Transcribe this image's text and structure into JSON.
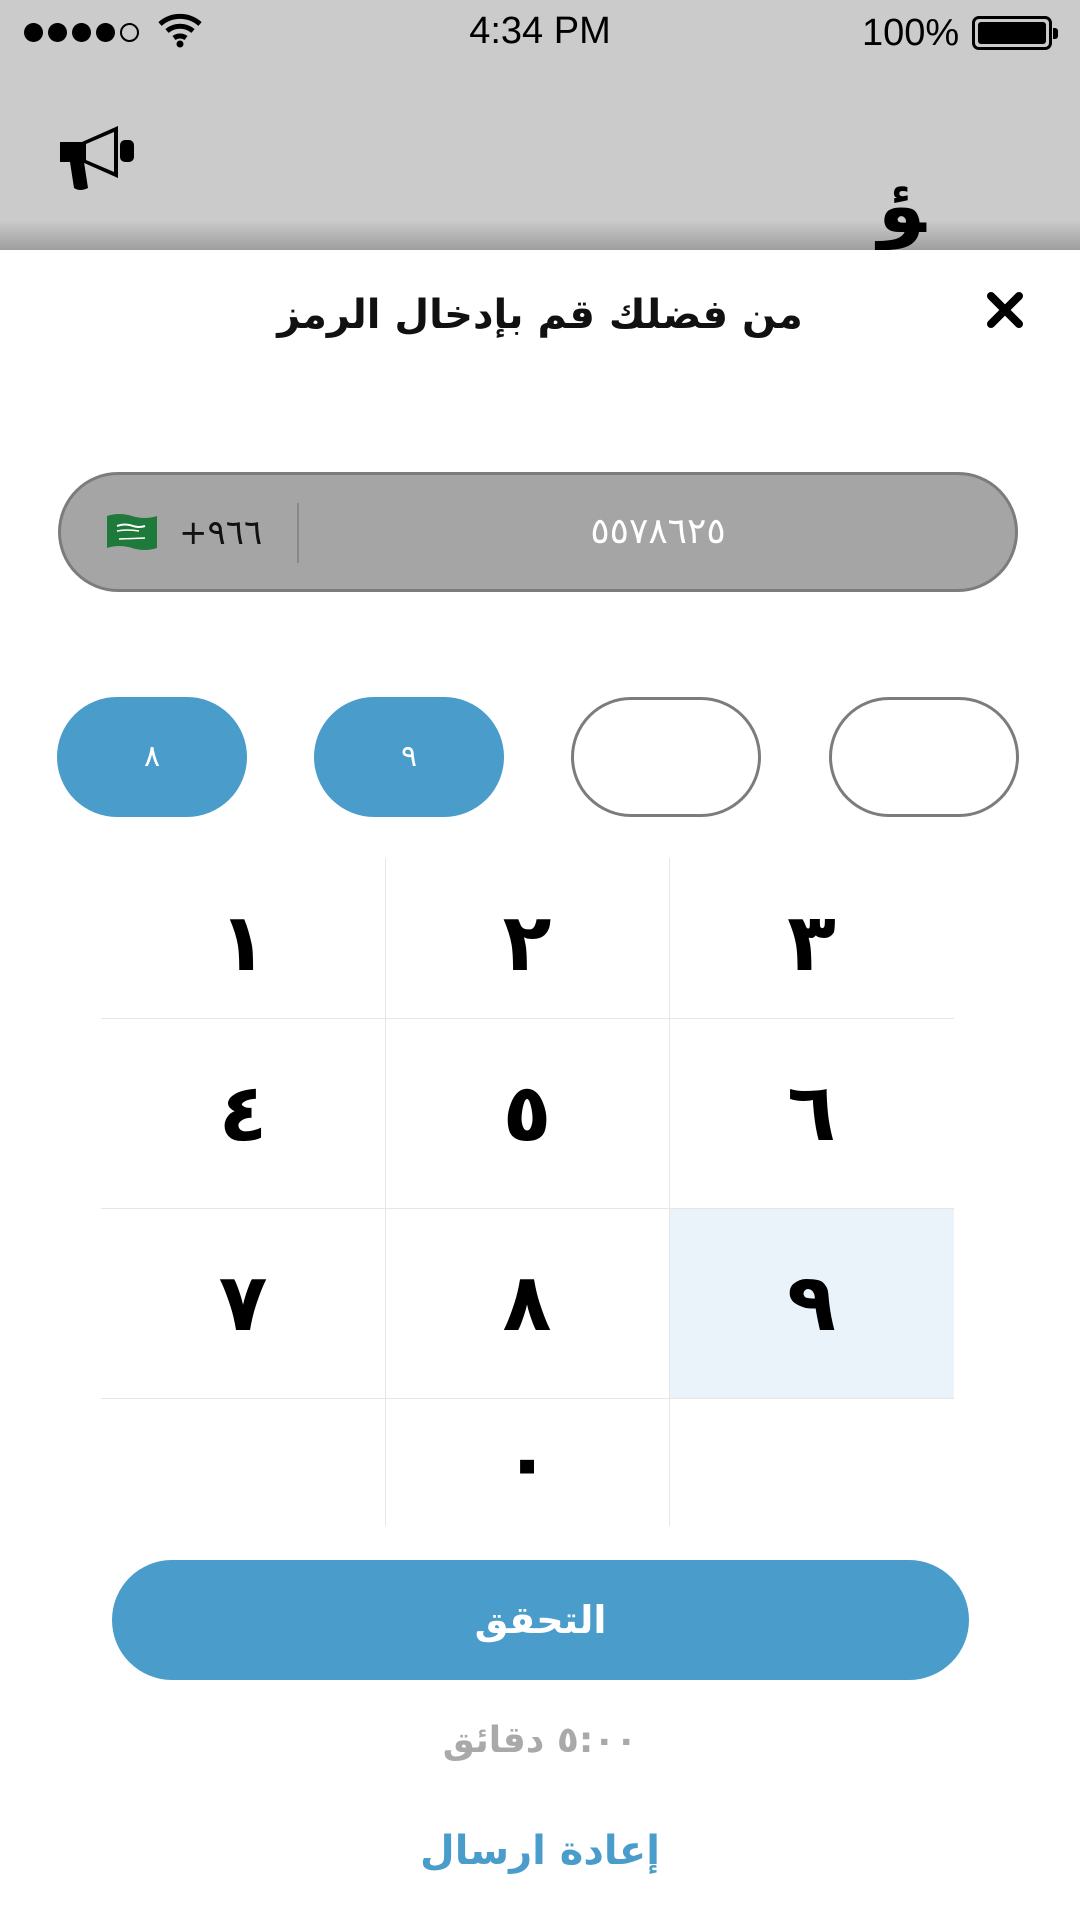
{
  "status_bar": {
    "time": "4:34 PM",
    "battery": "100%"
  },
  "background": {
    "glyph": "ﺆ"
  },
  "modal": {
    "title": "من فضلك قم بإدخال الرمز",
    "close_icon": "close-icon"
  },
  "phone": {
    "country_code": "+٩٦٦",
    "number": "٥٥٧٨٦٢٥",
    "flag": "saudi-arabia-flag-icon"
  },
  "otp": {
    "digits": [
      "٨",
      "٩",
      "",
      ""
    ]
  },
  "keypad": {
    "keys": [
      "١",
      "٢",
      "٣",
      "٤",
      "٥",
      "٦",
      "٧",
      "٨",
      "٩",
      "",
      "٠",
      ""
    ],
    "active_key": "٩"
  },
  "actions": {
    "verify_label": "التحقق",
    "timer": "٥:٠٠ دقائق",
    "resend_label": "إعادة ارسال"
  },
  "colors": {
    "accent": "#4a9ccb",
    "field_bg": "#a5a5a5",
    "active_key_bg": "#ebf3fa"
  }
}
